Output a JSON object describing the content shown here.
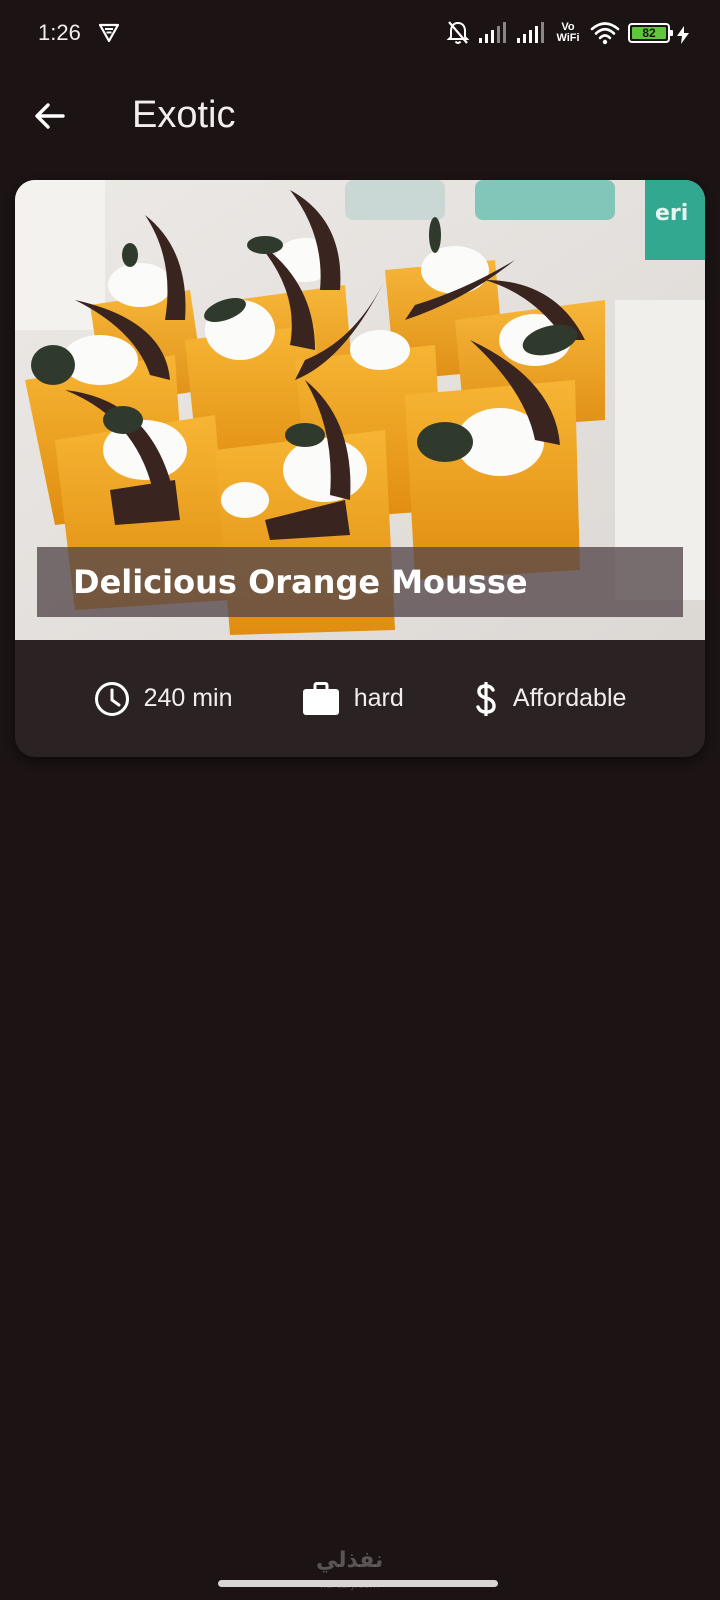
{
  "status_bar": {
    "time": "1:26",
    "vowifi_top": "Vo",
    "vowifi_bottom": "WiFi",
    "battery_level": "82",
    "icons": [
      "vpn-icon",
      "silent-bell-icon",
      "signal-icon",
      "signal-icon",
      "wifi-icon",
      "battery-icon",
      "charging-icon"
    ]
  },
  "app_bar": {
    "title": "Exotic",
    "back_icon": "arrow-back-icon"
  },
  "meal": {
    "title": "Delicious Orange Mousse",
    "duration": "240 min",
    "complexity": "hard",
    "affordability": "Affordable",
    "icons": {
      "duration": "schedule-icon",
      "complexity": "work-icon",
      "affordability": "attach-money-icon"
    }
  },
  "watermark": {
    "text": "نفذلي",
    "sub": "nafezly.com"
  },
  "colors": {
    "background": "#1b1314",
    "card": "#2a2223",
    "battery": "#5fc73b",
    "mousse": "#f0a020"
  }
}
